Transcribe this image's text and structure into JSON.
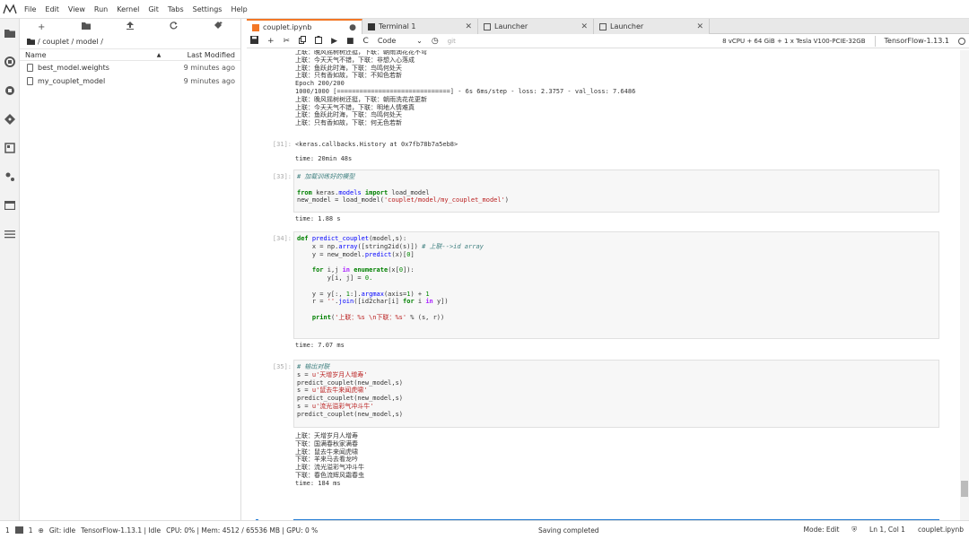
{
  "menubar": {
    "items": [
      "File",
      "Edit",
      "View",
      "Run",
      "Kernel",
      "Git",
      "Tabs",
      "Settings",
      "Help"
    ]
  },
  "filebrowser": {
    "breadcrumb": "/ couplet / model /",
    "col_name": "Name",
    "col_modified": "Last Modified",
    "files": [
      {
        "name": "best_model.weights",
        "modified": "9 minutes ago"
      },
      {
        "name": "my_couplet_model",
        "modified": "9 minutes ago"
      }
    ]
  },
  "tabs": [
    {
      "label": "couplet.ipynb",
      "active": true
    },
    {
      "label": "Terminal 1",
      "active": false
    },
    {
      "label": "Launcher",
      "active": false
    },
    {
      "label": "Launcher",
      "active": false
    }
  ],
  "notebook_toolbar": {
    "cell_type": "Code",
    "hardware": "8 vCPU + 64 GiB + 1 x Tesla V100-PCIE-32GB",
    "kernel": "TensorFlow-1.13.1"
  },
  "output_top": [
    "上联：晚风摇树树还挺，下联：朝雨润花花不弯",
    "上联：今天天气不错，下联：非想入心落成",
    "上联：鱼跃此时海，下联：鸟鸣何处天",
    "上联：只有香如故，下联：不知色若新",
    "Epoch 200/200",
    "1000/1000 [==============================] - 6s 6ms/step - loss: 2.3757 - val_loss: 7.6486",
    "上联：晚风摇树树还挺，下联：朝雨洗花花更新",
    "上联：今天天气不错，下联：明地人情难真",
    "上联：鱼跃此时海，下联：鸟鸣何处天",
    "上联：只有香如故，下联：何无色若新"
  ],
  "cells": {
    "c31": {
      "prompt": "[31]:",
      "out": "<keras.callbacks.History at 0x7fb78b7a5eb8>",
      "time": "time: 20min 48s"
    },
    "c33": {
      "prompt": "[33]:",
      "comment": "# 加载训练好的模型",
      "time": "time: 1.88 s"
    },
    "c34": {
      "prompt": "[34]:",
      "time": "time: 7.07 ms"
    },
    "c35": {
      "prompt": "[35]:",
      "comment": "# 输出对联",
      "time": "time: 184 ms"
    },
    "empty": {
      "prompt": "[ ]:"
    }
  },
  "couplet_output": [
    "上联：天增岁月人增寿",
    "下联：国满春秋家满春",
    "上联：鼠去牛来闻虎啸",
    "下联：羊来马去看龙吟",
    "上联：流光溢彩气冲斗牛",
    "下联：春色流辉风霜春虫"
  ],
  "statusbar": {
    "mode_num": "1",
    "terminals": "1",
    "git": "Git: idle",
    "kernel_status": "TensorFlow-1.13.1 | Idle",
    "resources": "CPU: 0% | Mem: 4512 / 65536 MB | GPU: 0 %",
    "saving": "Saving completed",
    "edit_mode": "Mode: Edit",
    "position": "Ln 1, Col 1",
    "filename": "couplet.ipynb"
  }
}
